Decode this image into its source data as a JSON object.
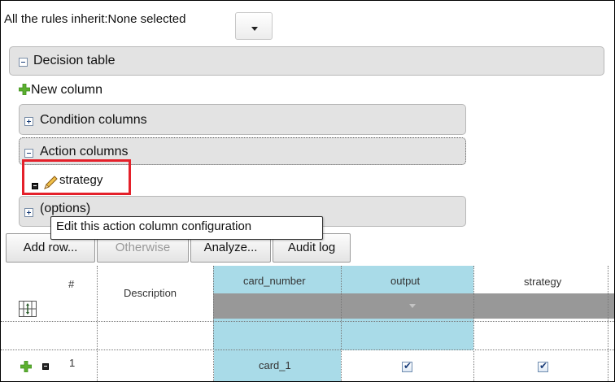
{
  "inherit": {
    "label": "All the rules inherit:None selected"
  },
  "tree": {
    "decision_table": "Decision table",
    "new_column": "New column",
    "condition_columns": "Condition columns",
    "action_columns": "Action columns",
    "strategy_item": "strategy",
    "options": "(options)"
  },
  "tooltip": "Edit this action column configuration",
  "toolbar": {
    "add_row": "Add row...",
    "otherwise": "Otherwise",
    "analyze": "Analyze...",
    "audit_log": "Audit log"
  },
  "table": {
    "headers": {
      "number": "#",
      "description": "Description",
      "card_number": "card_number",
      "output": "output",
      "strategy": "strategy"
    },
    "rows": [
      {
        "number": "1",
        "card_number": "card_1",
        "output_checked": true,
        "strategy_checked": true
      }
    ]
  },
  "colors": {
    "highlight": "#e4202a",
    "condition_header": "#a9dbe8",
    "dropdown_bar": "#989898"
  }
}
